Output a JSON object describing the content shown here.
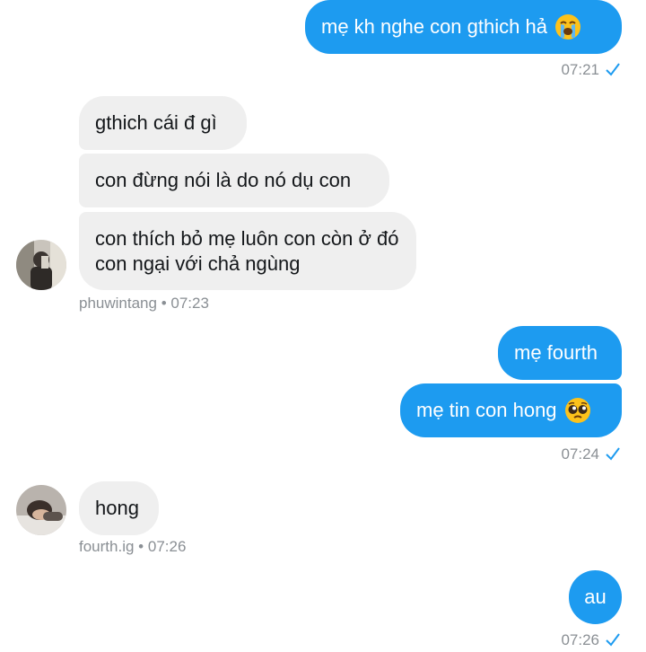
{
  "messages": [
    {
      "text": "mẹ kh nghe con gthich hả",
      "emoji": "loudly-crying-face-icon"
    },
    {
      "text": "gthich cái đ gì"
    },
    {
      "text": "con đừng nói là do nó dụ con"
    },
    {
      "text": "con thích bỏ mẹ luôn con còn ở đó con ngại với chả ngùng"
    },
    {
      "text": "mẹ fourth"
    },
    {
      "text": "mẹ tin con hong",
      "emoji": "pleading-face-icon"
    },
    {
      "text": "hong"
    },
    {
      "text": "au"
    }
  ],
  "meta": {
    "t1": "07:21",
    "g1_user": "phuwintang",
    "g1_time": "07:23",
    "t2": "07:24",
    "g2_user": "fourth.ig",
    "g2_time": "07:26",
    "t3": "07:26",
    "separator": "•"
  },
  "colors": {
    "outgoing": "#1d9bf0",
    "incoming": "#efefef",
    "meta_text": "#8a8f94"
  }
}
